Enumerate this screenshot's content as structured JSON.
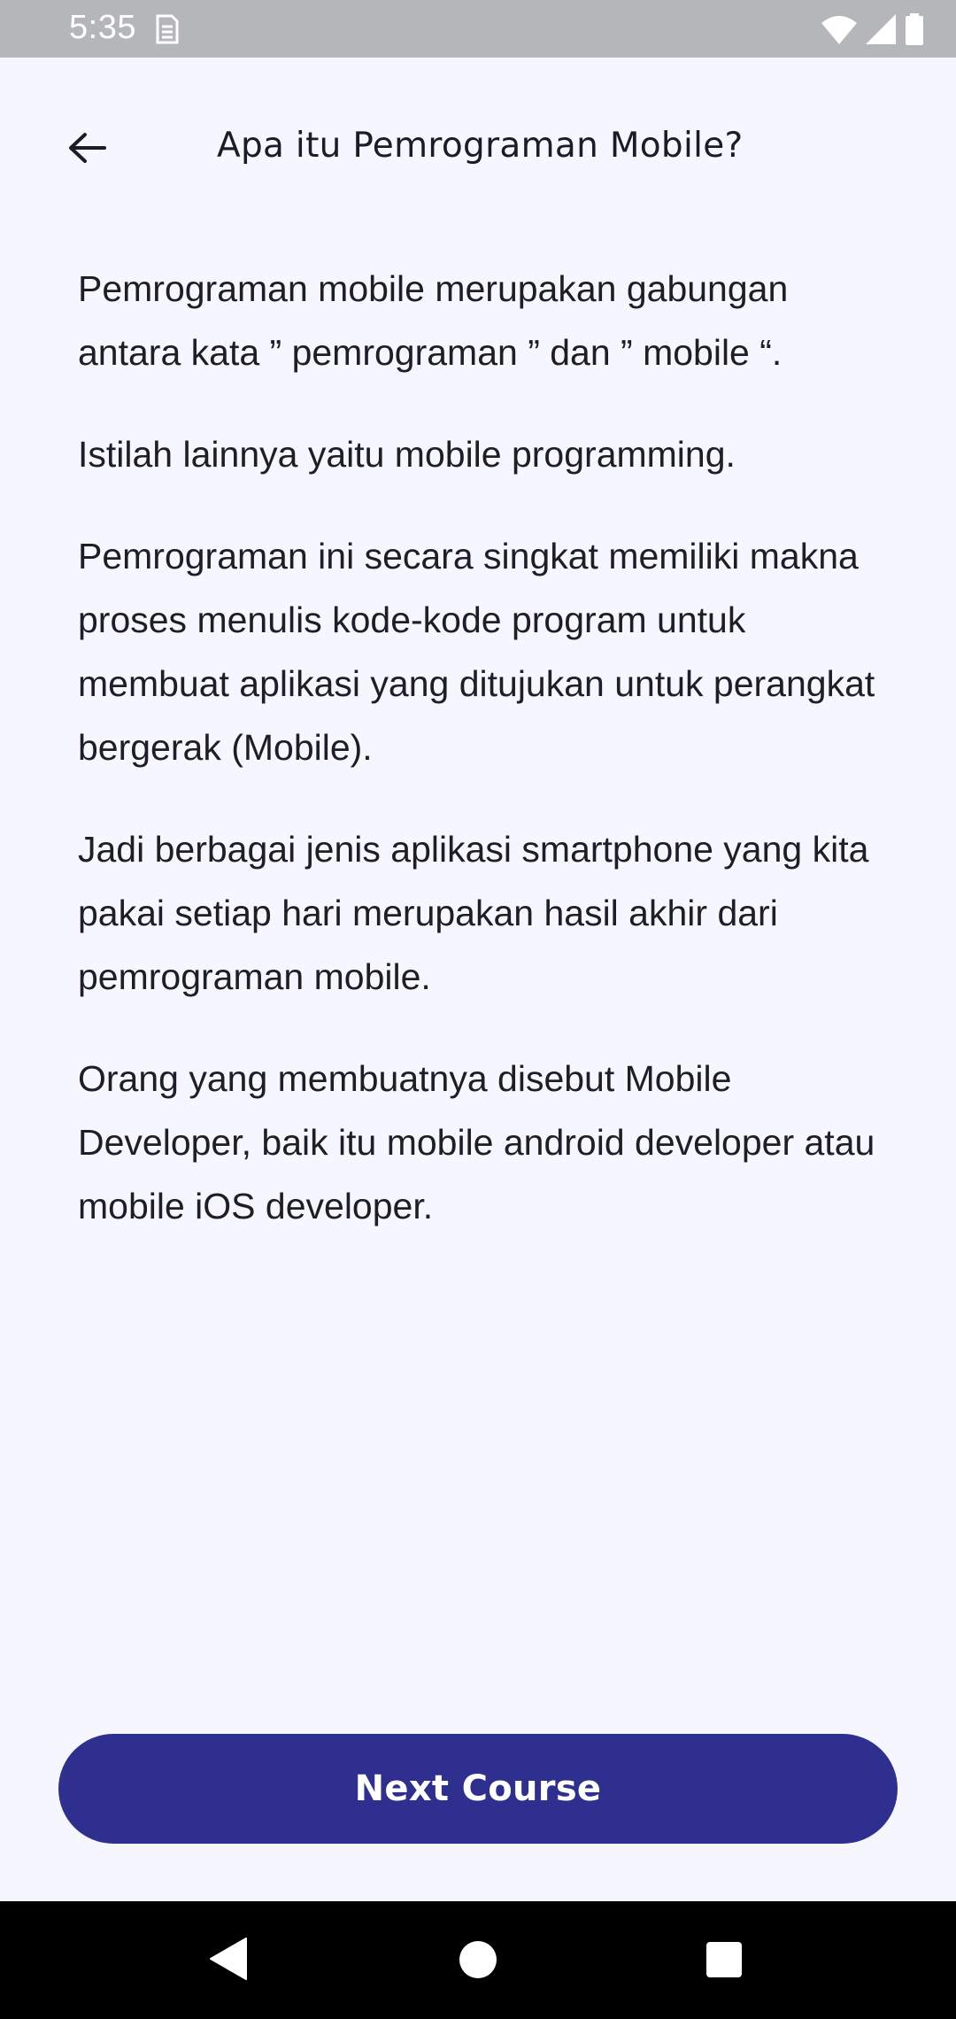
{
  "status_bar": {
    "time": "5:35",
    "icons": [
      "sim-card-icon",
      "wifi-icon",
      "cell-signal-icon",
      "battery-icon"
    ]
  },
  "header": {
    "title": "Apa itu Pemrograman Mobile?",
    "back_icon": "arrow-left-icon"
  },
  "content": {
    "paragraphs": [
      "Pemrograman mobile merupakan gabungan antara kata ” pemrograman ” dan ” mobile “.",
      "Istilah lainnya yaitu mobile programming.",
      "Pemrograman ini secara singkat memiliki makna proses menulis kode-kode program untuk membuat aplikasi yang ditujukan untuk perangkat bergerak (Mobile).",
      "Jadi berbagai jenis aplikasi smartphone yang kita pakai setiap hari merupakan hasil akhir dari pemrograman mobile.",
      "Orang yang membuatnya disebut Mobile Developer, baik itu mobile android developer atau mobile iOS developer."
    ]
  },
  "footer": {
    "next_label": "Next Course"
  },
  "nav_bar": {
    "icons": [
      "nav-back-icon",
      "nav-home-icon",
      "nav-recents-icon"
    ]
  },
  "colors": {
    "background": "#f5f6fe",
    "button": "#2e2f8f",
    "status_bar": "#b5b6ba",
    "nav_bar": "#000000"
  }
}
